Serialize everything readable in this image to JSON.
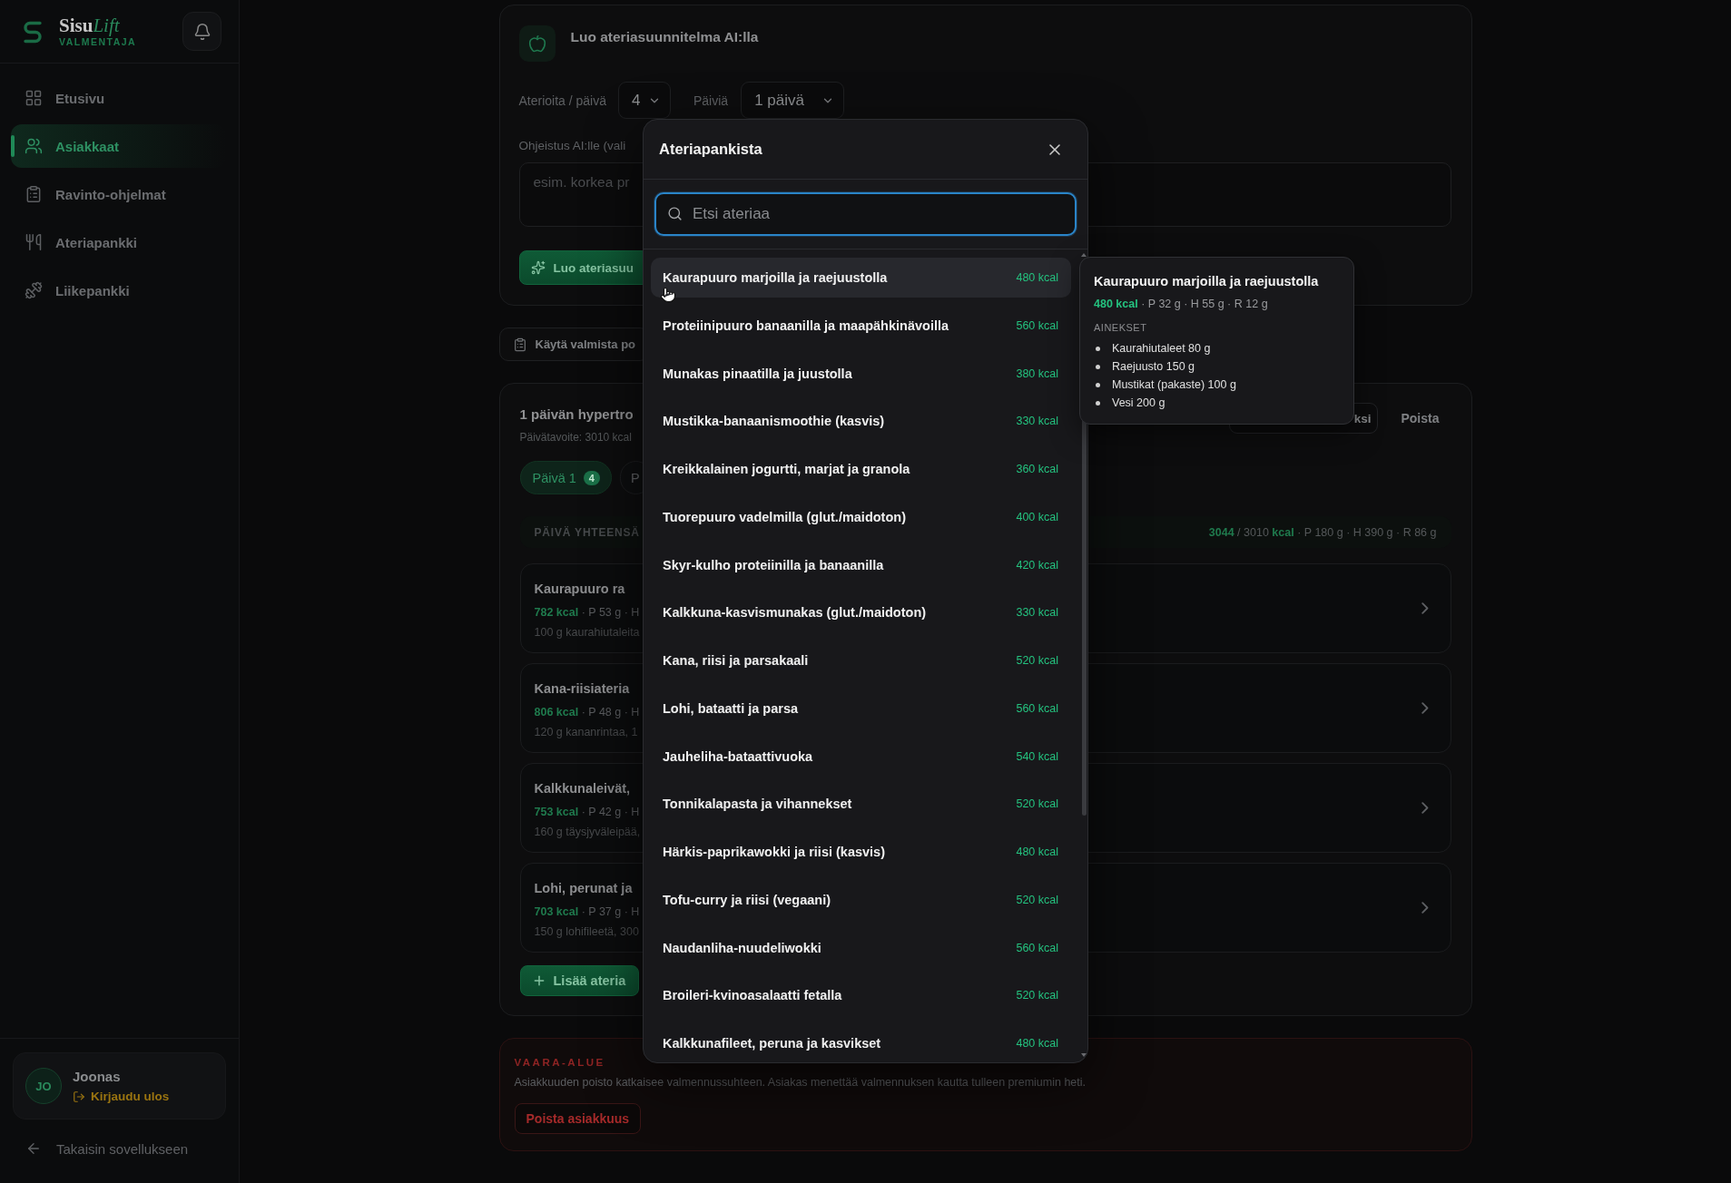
{
  "sidebar": {
    "brand": {
      "name": "Sisu",
      "name_accent": "Lift",
      "subtitle": "VALMENTAJA"
    },
    "nav": [
      {
        "label": "Etusivu",
        "selected": false
      },
      {
        "label": "Asiakkaat",
        "selected": true
      },
      {
        "label": "Ravinto-ohjelmat",
        "selected": false
      },
      {
        "label": "Ateriapankki",
        "selected": false
      },
      {
        "label": "Liikepankki",
        "selected": false
      }
    ],
    "user": {
      "initials": "JO",
      "name": "Joonas",
      "logout": "Kirjaudu ulos"
    },
    "back_link": "Takaisin sovellukseen"
  },
  "ai_plan_card": {
    "title": "Luo ateriasuunnitelma AI:lla",
    "meals_label": "Aterioita / päivä",
    "meals_value": "4",
    "days_label": "Päiviä",
    "days_value": "1 päivä",
    "instructions_label": "Ohjeistus AI:lle (vali",
    "instructions": {
      "placeholder": "esim. korkea pr"
    },
    "generate_button": "Luo ateriasuu"
  },
  "template_button": "Käytä valmista po",
  "plan_card": {
    "title": "1 päivän hypertro",
    "subtitle": "Päivätavoite: 3010 kcal",
    "actions": [
      {
        "label": "ksi",
        "kind": "outline"
      },
      {
        "label": "Poista",
        "kind": "ghost"
      }
    ],
    "day_tabs": [
      {
        "label": "Päivä 1",
        "count": "4",
        "selected": true
      },
      {
        "label": "P",
        "selected": false
      }
    ],
    "totals": {
      "label": "PÄIVÄ YHTEENSÄ",
      "kcal": "3044",
      "target": "/ 3010",
      "unit": "kcal",
      "macros": "· P 180 g · H 390 g · R 86 g"
    },
    "meals": [
      {
        "title": "Kaurapuuro ra",
        "kcal": "782 kcal",
        "macros": "· P 53 g · H",
        "ingredients": "100 g kaurahiutaleita"
      },
      {
        "title": "Kana-riisiateria",
        "kcal": "806 kcal",
        "macros": "· P 48 g · H",
        "ingredients": "120 g kananrintaa, 1"
      },
      {
        "title": "Kalkkunaleivät,",
        "kcal": "753 kcal",
        "macros": "· P 42 g · H",
        "ingredients": "160 g täysjyväleipää,"
      },
      {
        "title": "Lohi, perunat ja",
        "kcal": "703 kcal",
        "macros": "· P 37 g · H",
        "ingredients": "150 g lohifileetä, 300"
      }
    ],
    "add_button": "Lisää ateria"
  },
  "danger_zone": {
    "title": "VAARA-ALUE",
    "text": "Asiakkuuden poisto katkaisee valmennussuhteen. Asiakas menettää valmennuksen kautta tulleen premiumin heti.",
    "button": "Poista asiakkuus"
  },
  "meal_bank_modal": {
    "title": "Ateriapankista",
    "search": {
      "placeholder": "Etsi ateriaa"
    },
    "items": [
      {
        "name": "Kaurapuuro marjoilla ja raejuustolla",
        "kcal": "480 kcal",
        "highlighted": true
      },
      {
        "name": "Proteiinipuuro banaanilla ja maapähkinävoilla",
        "kcal": "560 kcal",
        "highlighted": false
      },
      {
        "name": "Munakas pinaatilla ja juustolla",
        "kcal": "380 kcal",
        "highlighted": false
      },
      {
        "name": "Mustikka-banaanismoothie (kasvis)",
        "kcal": "330 kcal",
        "highlighted": false
      },
      {
        "name": "Kreikkalainen jogurtti, marjat ja granola",
        "kcal": "360 kcal",
        "highlighted": false
      },
      {
        "name": "Tuorepuuro vadelmilla (glut./maidoton)",
        "kcal": "400 kcal",
        "highlighted": false
      },
      {
        "name": "Skyr-kulho proteiinilla ja banaanilla",
        "kcal": "420 kcal",
        "highlighted": false
      },
      {
        "name": "Kalkkuna-kasvismunakas (glut./maidoton)",
        "kcal": "330 kcal",
        "highlighted": false
      },
      {
        "name": "Kana, riisi ja parsakaali",
        "kcal": "520 kcal",
        "highlighted": false
      },
      {
        "name": "Lohi, bataatti ja parsa",
        "kcal": "560 kcal",
        "highlighted": false
      },
      {
        "name": "Jauheliha-bataattivuoka",
        "kcal": "540 kcal",
        "highlighted": false
      },
      {
        "name": "Tonnikalapasta ja vihannekset",
        "kcal": "520 kcal",
        "highlighted": false
      },
      {
        "name": "Härkis-paprikawokki ja riisi (kasvis)",
        "kcal": "480 kcal",
        "highlighted": false
      },
      {
        "name": "Tofu-curry ja riisi (vegaani)",
        "kcal": "520 kcal",
        "highlighted": false
      },
      {
        "name": "Naudanliha-nuudeliwokki",
        "kcal": "560 kcal",
        "highlighted": false
      },
      {
        "name": "Broileri-kvinoasalaatti fetalla",
        "kcal": "520 kcal",
        "highlighted": false
      },
      {
        "name": "Kalkkunafileet, peruna ja kasvikset",
        "kcal": "480 kcal",
        "highlighted": false
      }
    ]
  },
  "meal_tooltip": {
    "title": "Kaurapuuro marjoilla ja raejuustolla",
    "kcal": "480 kcal",
    "macros": "· P 32 g · H 55 g · R 12 g",
    "section_label": "AINEKSET",
    "ingredients": [
      "Kaurahiutaleet 80 g",
      "Raejuusto 150 g",
      "Mustikat (pakaste) 100 g",
      "Vesi 200 g"
    ]
  }
}
